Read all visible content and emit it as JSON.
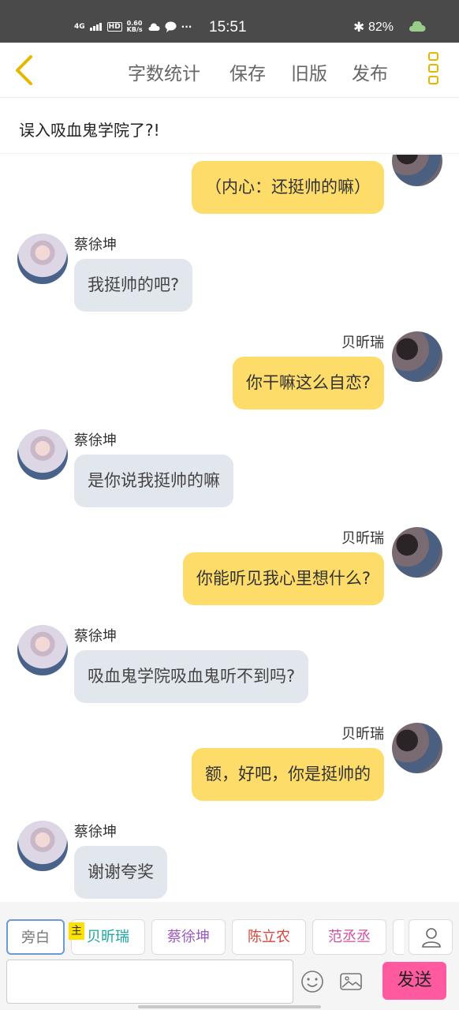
{
  "status_bar": {
    "network": "4G",
    "hd": "HD",
    "speed": "0.60",
    "speed_unit": "KB/s",
    "more": "···",
    "time": "15:51",
    "battery": "82%"
  },
  "toolbar": {
    "word_count": "字数统计",
    "save": "保存",
    "old_version": "旧版",
    "publish": "发布"
  },
  "story_title": "误入吸血鬼学院了?!",
  "messages": [
    {
      "speaker": "",
      "side": "right",
      "text": "（内心：还挺帅的嘛）"
    },
    {
      "speaker": "蔡徐坤",
      "side": "left",
      "text": "我挺帅的吧?"
    },
    {
      "speaker": "贝昕瑞",
      "side": "right",
      "text": "你干嘛这么自恋?"
    },
    {
      "speaker": "蔡徐坤",
      "side": "left",
      "text": "是你说我挺帅的嘛"
    },
    {
      "speaker": "贝昕瑞",
      "side": "right",
      "text": "你能听见我心里想什么?"
    },
    {
      "speaker": "蔡徐坤",
      "side": "left",
      "text": "吸血鬼学院吸血鬼听不到吗?"
    },
    {
      "speaker": "贝昕瑞",
      "side": "right",
      "text": "额，好吧，你是挺帅的"
    },
    {
      "speaker": "蔡徐坤",
      "side": "left",
      "text": "谢谢夸奖"
    }
  ],
  "characters": {
    "host_badge": "主",
    "tabs": [
      {
        "label": "旁白",
        "color": "#777777"
      },
      {
        "label": "贝昕瑞",
        "color": "#1aa6a0"
      },
      {
        "label": "蔡徐坤",
        "color": "#9a5bc0"
      },
      {
        "label": "陈立农",
        "color": "#d8463c"
      },
      {
        "label": "范丞丞",
        "color": "#d04fa0"
      }
    ]
  },
  "input": {
    "placeholder": "",
    "send": "发送"
  },
  "colors": {
    "accent": "#e5b800",
    "bubble_me": "#fddc6a",
    "bubble_other": "#e2e6ed",
    "send_button": "#ff5aa0"
  }
}
